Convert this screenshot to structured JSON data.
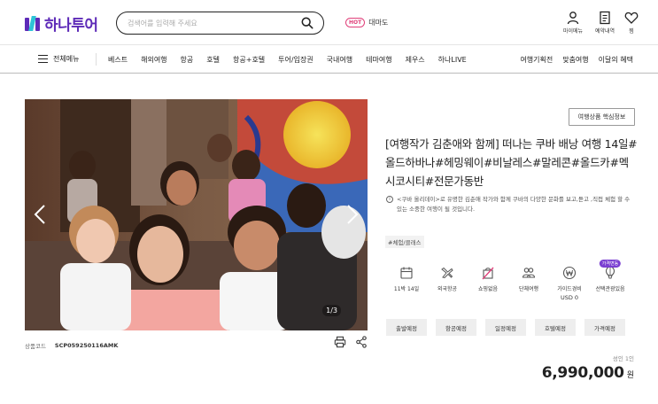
{
  "header": {
    "logo_text": "하나투어",
    "search_placeholder": "검색어를 입력해 주세요",
    "hot_badge": "HOT",
    "hot_keyword": "대마도",
    "utils": [
      {
        "label": "마이메뉴",
        "icon": "user-icon"
      },
      {
        "label": "예약내역",
        "icon": "document-icon"
      },
      {
        "label": "찜",
        "icon": "heart-icon"
      }
    ]
  },
  "nav": {
    "menu_label": "전체메뉴",
    "items": [
      "베스트",
      "해외여행",
      "항공",
      "호텔",
      "항공+호텔",
      "투어/입장권",
      "국내여행",
      "테마여행",
      "제우스",
      "하나LIVE"
    ],
    "right_items": [
      "여행기획전",
      "맞춤여행",
      "이달의 혜택"
    ]
  },
  "gallery": {
    "counter": "1/3"
  },
  "product": {
    "code_label": "상품코드",
    "code_value": "SCP059250116AMK",
    "info_button": "여행상품 핵심정보",
    "title": "[여행작가 김춘애와 함께] 떠나는 쿠바 배낭 여행 14일#올드하바나#헤밍웨이#비날레스#말레콘#올드카#멕시코시티#전문가동반",
    "description": "<쿠바 올리데이>로 유명한 김춘애 작가와 함께 쿠바의 다양한 문화를 보고,듣고 ,직접 체험 할 수 있는 소중한 여행이 될 것입니다.",
    "tag": "#체험/클래스",
    "features": [
      {
        "label": "11박 14일",
        "icon": "calendar-icon"
      },
      {
        "label": "외국항공",
        "icon": "airplane-icon"
      },
      {
        "label": "쇼핑없음",
        "icon": "no-shopping-icon"
      },
      {
        "label": "단체여행",
        "icon": "group-icon"
      },
      {
        "label": "가이드경비",
        "sub": "USD 0",
        "icon": "won-coin-icon"
      },
      {
        "label": "선택관광있음",
        "badge": "가격변동",
        "icon": "balloon-icon"
      }
    ],
    "tabs": [
      "출발예정",
      "항공예정",
      "일정예정",
      "호텔예정",
      "가격예정"
    ],
    "price_label": "성인 1인",
    "price_value": "6,990,000",
    "price_unit": "원"
  },
  "colors": {
    "brand": "#5e2bb8",
    "accent": "#2ec4d6",
    "hot": "#e0407a"
  }
}
